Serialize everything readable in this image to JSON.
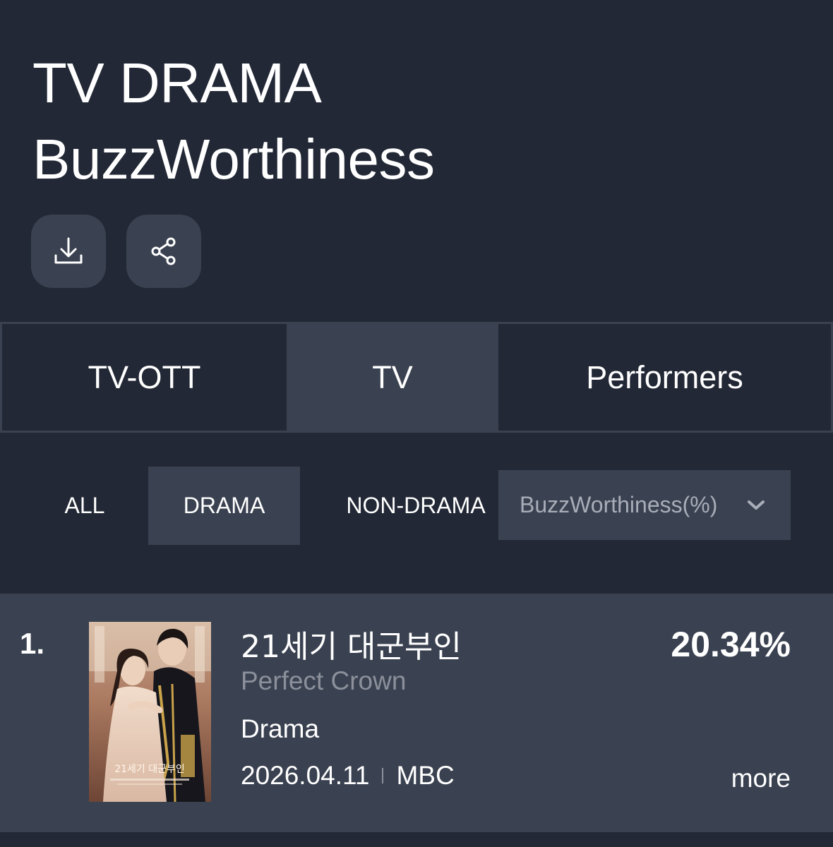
{
  "header": {
    "title_line1": "TV DRAMA",
    "title_line2": "BuzzWorthiness"
  },
  "actions": [
    {
      "icon": "download-icon"
    },
    {
      "icon": "share-icon"
    }
  ],
  "tabs": [
    {
      "label": "TV-OTT",
      "active": false
    },
    {
      "label": "TV",
      "active": true
    },
    {
      "label": "Performers",
      "active": false
    }
  ],
  "subtabs": [
    {
      "label": "ALL",
      "active": false
    },
    {
      "label": "DRAMA",
      "active": true
    },
    {
      "label": "NON-DRAMA",
      "active": false
    }
  ],
  "metric_select": {
    "value": "BuzzWorthiness(%)",
    "icon": "chevron-down-icon"
  },
  "rankings": [
    {
      "rank": "1.",
      "title_ko": "21세기 대군부인",
      "title_en": "Perfect Crown",
      "genre": "Drama",
      "date": "2026.04.11",
      "channel": "MBC",
      "score": "20.34%",
      "more_label": "more",
      "poster_text": "21세기 대군부인"
    }
  ],
  "colors": {
    "background": "#222835",
    "panel": "#3a4150",
    "muted_text": "#8b909b"
  }
}
